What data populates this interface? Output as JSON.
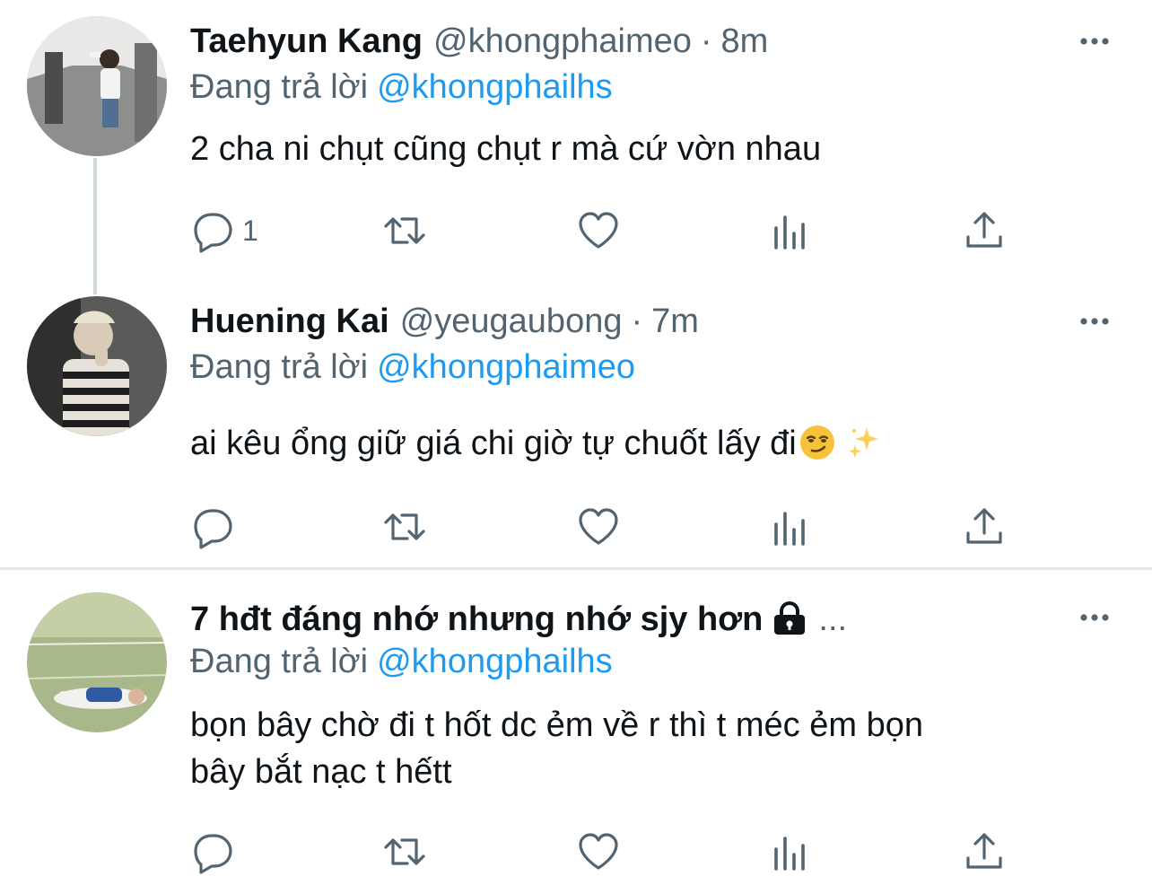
{
  "tweets": [
    {
      "name": "Taehyun Kang",
      "handle": "@khongphaimeo",
      "dot": "·",
      "time": "8m",
      "replying_label": "Đang trả lời",
      "replying_to": "@khongphailhs",
      "text": "2 cha ni chụt cũng chụt r mà cứ vờn nhau",
      "reply_count": "1"
    },
    {
      "name": "Huening Kai",
      "handle": "@yeugaubong",
      "dot": "·",
      "time": "7m",
      "replying_label": "Đang trả lời",
      "replying_to": "@khongphaimeo",
      "text": "ai kêu ổng giữ giá chi giờ tự chuốt lấy đi",
      "reply_count": ""
    },
    {
      "name": "7 hđt đáng nhớ nhưng nhớ sjy hơn",
      "ellipsis": "...",
      "replying_label": "Đang trả lời",
      "replying_to": "@khongphailhs",
      "text_line1": "bọn bây chờ đi t hốt dc ẻm về r thì t méc ẻm bọn",
      "text_line2": "bây bắt nạc t hếtt",
      "reply_count": ""
    }
  ],
  "colors": {
    "link": "#1d9bf0",
    "secondary": "#536471",
    "thread_line": "#cfd9de",
    "divider": "#e3e7ea"
  },
  "icons": {
    "more": "more-icon",
    "reply": "reply-icon",
    "retweet": "retweet-icon",
    "like": "like-icon",
    "views": "views-icon",
    "share": "share-icon",
    "lock": "lock-icon"
  }
}
